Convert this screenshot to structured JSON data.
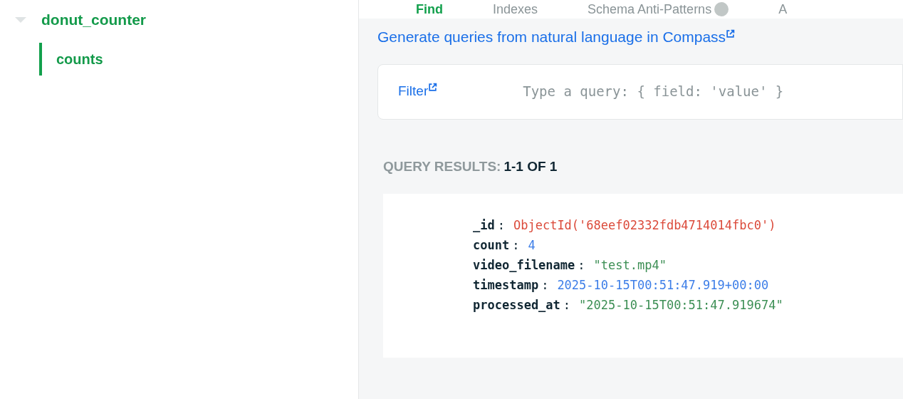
{
  "sidebar": {
    "database": {
      "name": "donut_counter",
      "expanded": true,
      "children": [
        {
          "name": "counts",
          "selected": true
        }
      ]
    }
  },
  "tabs": [
    {
      "label": "Find",
      "selected": true,
      "badge": false
    },
    {
      "label": "Indexes",
      "selected": false,
      "badge": false
    },
    {
      "label": "Schema Anti-Patterns",
      "selected": false,
      "badge": true
    },
    {
      "label": "A",
      "selected": false,
      "badge": false
    }
  ],
  "compass_link": "Generate queries from natural language in Compass",
  "filter": {
    "label": "Filter",
    "placeholder": "Type a query: { field: 'value' }"
  },
  "results": {
    "label": "QUERY RESULTS:",
    "range": "1-1 OF 1"
  },
  "document": [
    {
      "key": "_id",
      "separator": ":",
      "value": "ObjectId('68eef02332fdb4714014fbc0')",
      "kind": "objectid"
    },
    {
      "key": "count",
      "separator": ":",
      "value": "4",
      "kind": "number"
    },
    {
      "key": "video_filename",
      "separator": ":",
      "value": "\"test.mp4\"",
      "kind": "string"
    },
    {
      "key": "timestamp",
      "separator": ":",
      "value": "2025-10-15T00:51:47.919+00:00",
      "kind": "date"
    },
    {
      "key": "processed_at",
      "separator": ":",
      "value": "\"2025-10-15T00:51:47.919674\"",
      "kind": "string"
    }
  ]
}
